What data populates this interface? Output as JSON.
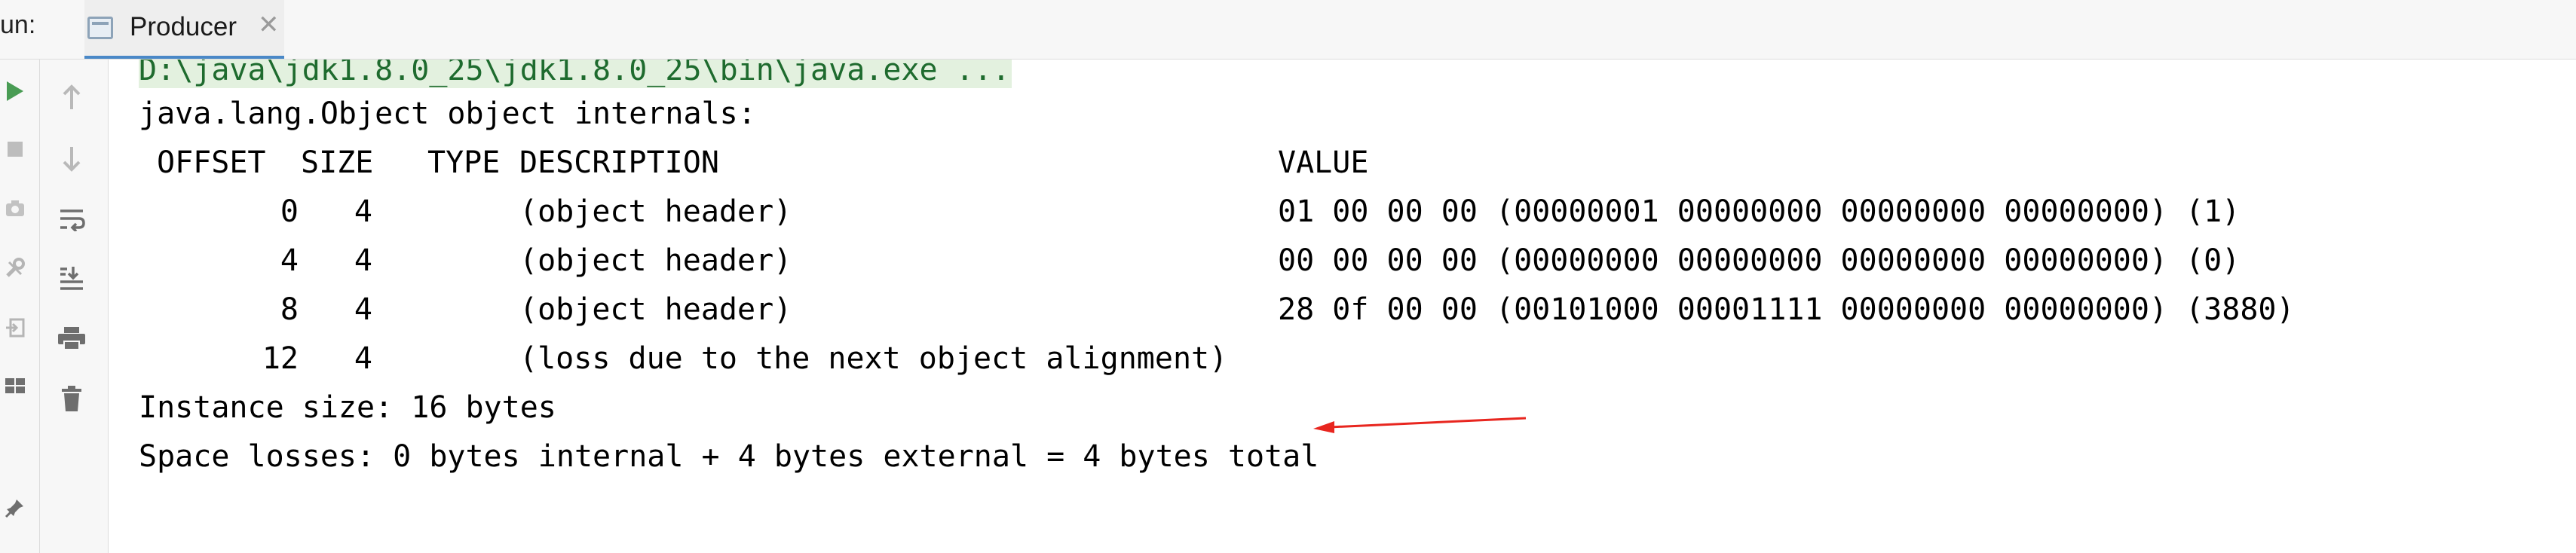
{
  "header": {
    "run_label": "un:",
    "tab_label": "Producer",
    "tab_icon": "console-icon",
    "close_icon": "close-icon"
  },
  "outer_toolbar": {
    "icons": [
      "run-icon",
      "stop-icon",
      "camera-icon",
      "tools-icon",
      "login-icon",
      "layout-icon",
      "pin-icon"
    ],
    "colors": {
      "run": "#499c54",
      "icon": "#8c8c8c"
    }
  },
  "inner_toolbar": {
    "icons": [
      "up-arrow-icon",
      "down-arrow-icon",
      "soft-wrap-icon",
      "scroll-to-end-icon",
      "print-icon",
      "trash-icon"
    ]
  },
  "console": {
    "command_line": "D:\\java\\jdk1.8.0_25\\jdk1.8.0_25\\bin\\java.exe ...",
    "heading": "java.lang.Object object internals:",
    "table": {
      "headers": {
        "offset": "OFFSET",
        "size": "SIZE",
        "type": "TYPE",
        "description": "DESCRIPTION",
        "value": "VALUE"
      },
      "rows": [
        {
          "offset": "0",
          "size": "4",
          "type": "",
          "description": "(object header)",
          "value": "01 00 00 00 (00000001 00000000 00000000 00000000) (1)"
        },
        {
          "offset": "4",
          "size": "4",
          "type": "",
          "description": "(object header)",
          "value": "00 00 00 00 (00000000 00000000 00000000 00000000) (0)"
        },
        {
          "offset": "8",
          "size": "4",
          "type": "",
          "description": "(object header)",
          "value": "28 0f 00 00 (00101000 00001111 00000000 00000000) (3880)"
        },
        {
          "offset": "12",
          "size": "4",
          "type": "",
          "description": "(loss due to the next object alignment)",
          "value": ""
        }
      ]
    },
    "instance_size": "Instance size: 16 bytes",
    "space_losses": "Space losses: 0 bytes internal + 4 bytes external = 4 bytes total",
    "annotation_color": "#e8261f",
    "command_line_bg": "#e3f1df"
  }
}
